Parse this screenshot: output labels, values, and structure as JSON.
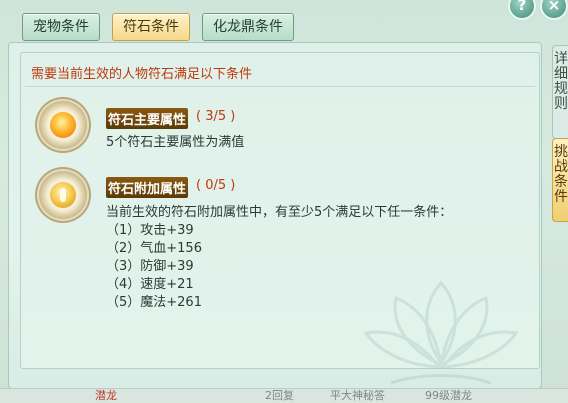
{
  "tabs": [
    {
      "label": "宠物条件",
      "active": false
    },
    {
      "label": "符石条件",
      "active": true
    },
    {
      "label": "化龙鼎条件",
      "active": false
    }
  ],
  "window_buttons": {
    "help": "?",
    "close": "×"
  },
  "side_tabs": [
    {
      "label": "详细规则"
    },
    {
      "label": "挑战条件"
    }
  ],
  "panel": {
    "header": "需要当前生效的人物符石满足以下条件",
    "sections": [
      {
        "title": "符石主要属性",
        "count": "( 3/5 )",
        "lines": [
          "5个符石主要属性为满值"
        ]
      },
      {
        "title": "符石附加属性",
        "count": "( 0/5 )",
        "lines": [
          "当前生效的符石附加属性中，有至少5个满足以下任一条件：",
          "（1）攻击+39",
          "（2）气血+156",
          "（3）防御+39",
          "（4）速度+21",
          "（5）魔法+261"
        ]
      }
    ]
  },
  "bottom_strip": [
    "潜龙",
    "2回复",
    "平大神秘答",
    "99级潜龙"
  ],
  "colors": {
    "accent_red": "#c0390b",
    "title_bg": "#6e470c",
    "panel_bg": "#e1f2eb",
    "active_tab": "#f4d98a"
  }
}
